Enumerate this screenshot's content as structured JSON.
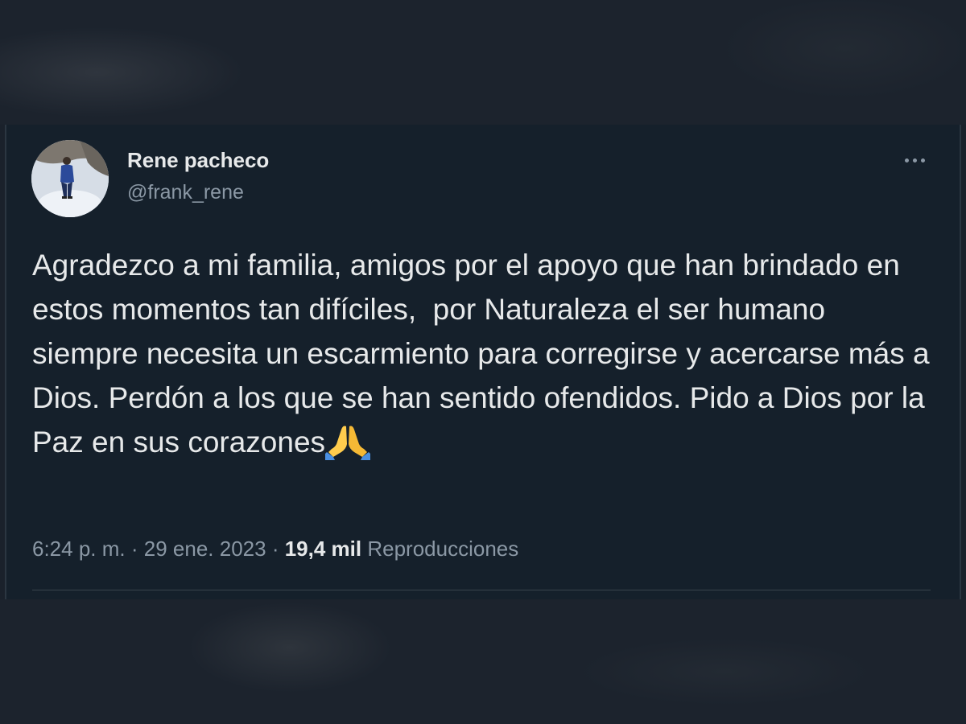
{
  "tweet": {
    "author": {
      "name": "Rene pacheco",
      "handle": "@frank_rene",
      "avatar_icon": "profile-photo"
    },
    "more_icon": "more-horizontal-icon",
    "text": "Agradezco a mi familia, amigos por el apoyo que han brindado en estos momentos tan difíciles,  por Naturaleza el ser humano siempre necesita un escarmiento para corregirse y acercarse más a Dios. Perdón a los que se han sentido ofendidos. Pido a Dios por la Paz en sus corazones",
    "emoji": "folded-hands-emoji",
    "meta": {
      "time": "6:24 p. m.",
      "separator": "·",
      "date": "29 ene. 2023",
      "views_count": "19,4 mil",
      "views_label": "Reproducciones"
    }
  },
  "colors": {
    "background": "#15202b",
    "primary_text": "#e7e9ea",
    "secondary_text": "#8b98a5",
    "divider": "#38444d"
  }
}
